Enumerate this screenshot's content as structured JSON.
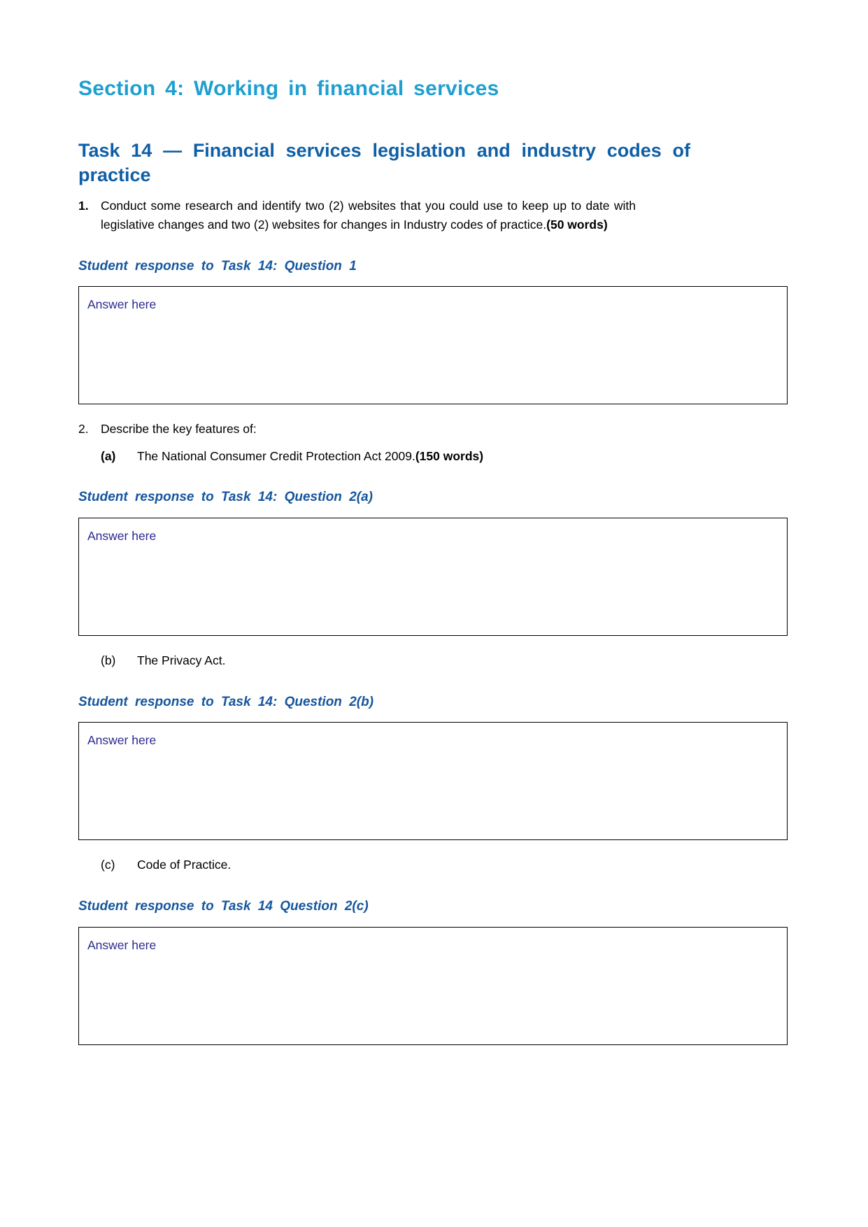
{
  "document": {
    "section_heading": "Section 4:  Working in financial services",
    "task_heading": "Task 14 — Financial services legislation and industry codes of practice",
    "colors": {
      "section_heading": "#1F9FD0",
      "task_heading": "#0F5FA6",
      "response_heading": "#15569E",
      "answer_text": "#2A2A8C",
      "box_border": "#000000",
      "body_text": "#000000"
    }
  },
  "questions": [
    {
      "number": "1.",
      "text_part1": "Conduct some research and identify two (2) websites that you could use to keep up to date with legislative changes and two (2) websites for changes in Industry codes of practice.",
      "text_bold": "(50 words)",
      "response_heading": "Student response to Task 14: Question 1",
      "answer_placeholder": "Answer here"
    },
    {
      "number": "2.",
      "text_part1": "Describe the key features of:",
      "sub_items": [
        {
          "letter": "(a)",
          "letter_bold": true,
          "text_part1": "The National Consumer Credit Protection Act 2009.",
          "text_bold": "(150 words)",
          "response_heading": "Student response to Task 14: Question 2(a)",
          "answer_placeholder": "Answer here"
        },
        {
          "letter": "(b)",
          "letter_bold": false,
          "text_part1": "The Privacy Act.",
          "text_bold": "",
          "response_heading": "Student response to Task 14: Question 2(b)",
          "answer_placeholder": "Answer here"
        },
        {
          "letter": "(c)",
          "letter_bold": false,
          "text_part1": "Code of Practice.",
          "text_bold": "",
          "response_heading": "Student response to Task 14 Question 2(c)",
          "answer_placeholder": "Answer here"
        }
      ]
    }
  ]
}
